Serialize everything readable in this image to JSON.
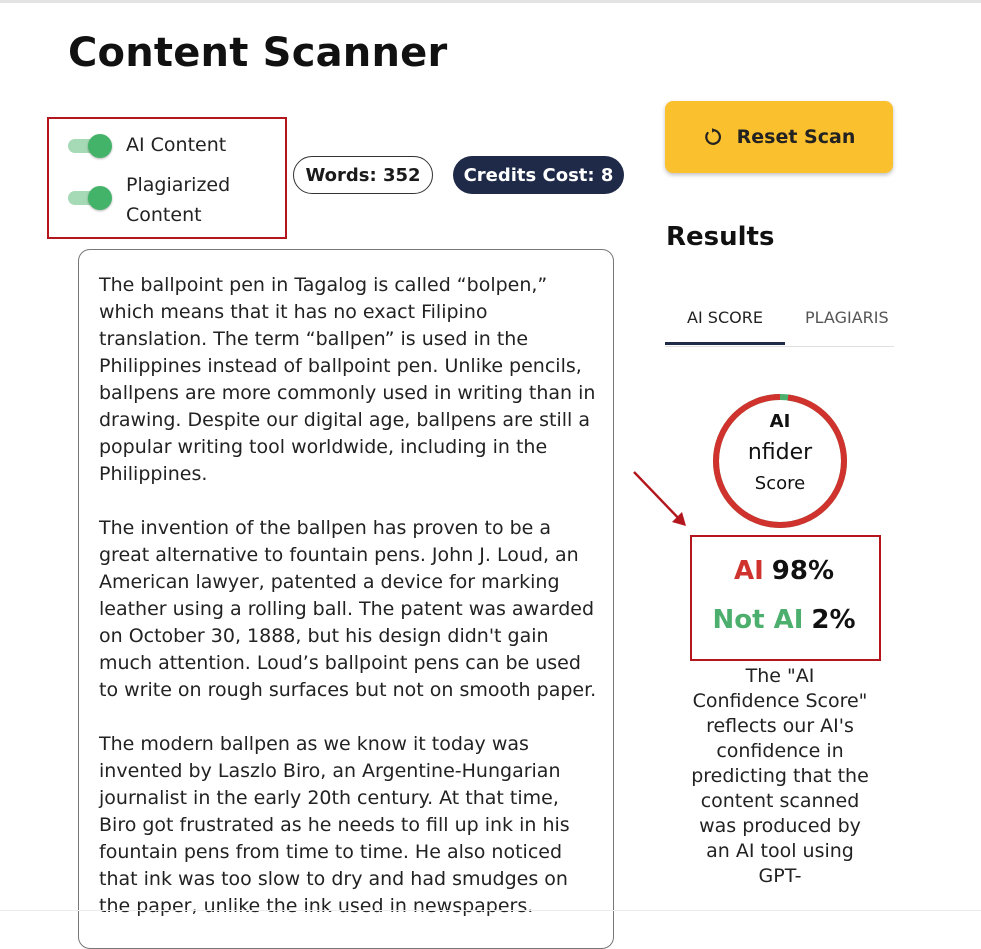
{
  "page": {
    "title": "Content Scanner"
  },
  "toggles": [
    {
      "label": "AI Content",
      "on": true
    },
    {
      "label": "Plagiarized Content",
      "on": true
    }
  ],
  "stats": {
    "words": "Words: 352",
    "credits": "Credits Cost: 8"
  },
  "document": {
    "paragraphs": [
      "The ballpoint pen in Tagalog is called “bolpen,” which means that it has no exact Filipino translation. The term “ballpen” is used in the Philippines instead of ballpoint pen. Unlike pencils, ballpens are more commonly used in writing than in drawing. Despite our digital age, ballpens are still a popular writing tool worldwide, including in the Philippines.",
      "The invention of the ballpen has proven to be a great alternative to fountain pens. John J. Loud, an American lawyer, patented a device for marking leather using a rolling ball. The patent was awarded on October 30, 1888, but his design didn't gain much attention.  Loud’s ballpoint pens can be used to write on rough surfaces but not on smooth paper.",
      "The modern ballpen as we know it today was invented by Laszlo Biro, an Argentine-Hungarian journalist in the early 20th century. At that time, Biro got frustrated as he needs  to fill up ink in his fountain pens from time to time. He also noticed that ink was too slow to dry and had smudges on the paper, unlike the ink used in newspapers."
    ]
  },
  "actions": {
    "reset_label": "Reset Scan"
  },
  "results": {
    "heading": "Results",
    "tabs": [
      "AI SCORE",
      "PLAGIARIS"
    ],
    "gauge": {
      "line1": "AI",
      "line2": "nfider",
      "line3": "Score",
      "ai_fraction": 0.98
    },
    "scores": {
      "ai_label": "AI",
      "ai_value": "98%",
      "notai_label": "Not AI",
      "notai_value": "2%"
    },
    "description": "The \"AI Confidence Score\" reflects our AI's confidence in predicting that the content scanned was produced by an AI tool using GPT-"
  },
  "colors": {
    "accent_navy": "#1f2a48",
    "button_yellow": "#fbc02d",
    "toggle_green": "#43b36a",
    "ai_red": "#d0322d",
    "notai_green": "#4caf6e",
    "annotation_red": "#b3161c"
  }
}
